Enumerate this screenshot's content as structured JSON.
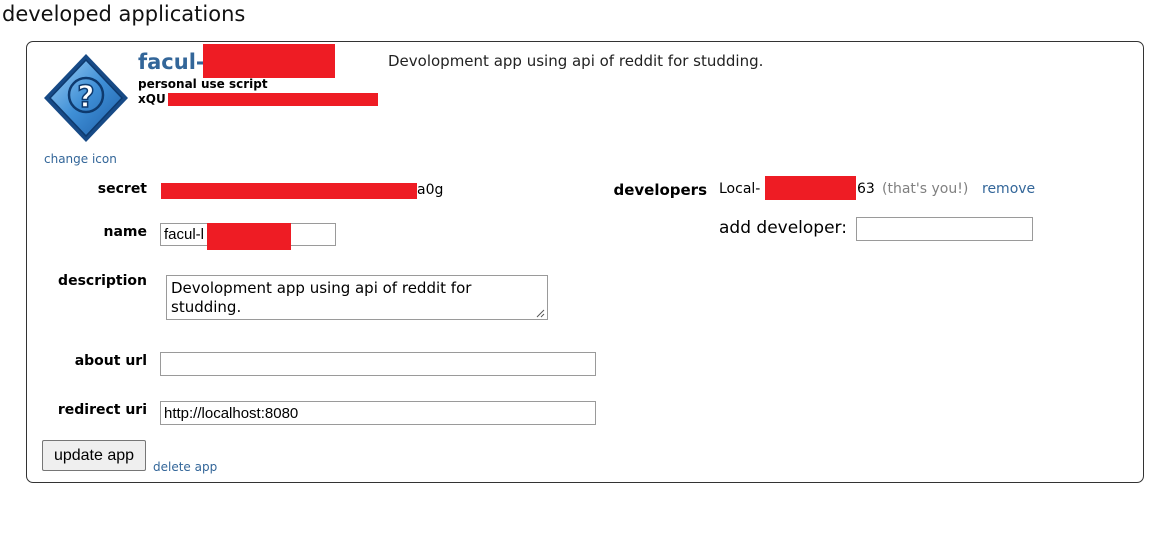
{
  "section_title": "developed applications",
  "app": {
    "name_prefix": "facul-",
    "type": "personal use script",
    "id_prefix": "xQU",
    "description_display": "Devolopment app using api of reddit for studding.",
    "change_icon_label": "change icon",
    "icon": "question-mark-diamond-icon"
  },
  "form": {
    "secret_label": "secret",
    "secret_suffix": "a0g",
    "name_label": "name",
    "name_value": "facul-l",
    "description_label": "description",
    "description_value": "Devolopment app using api of reddit for studding.",
    "about_url_label": "about url",
    "about_url_value": "",
    "redirect_uri_label": "redirect uri",
    "redirect_uri_value": "http://localhost:8080",
    "update_button": "update app",
    "delete_link": "delete app"
  },
  "developers": {
    "label": "developers",
    "name_prefix": "Local-",
    "name_suffix": "63",
    "you_note": "(that's you!)",
    "remove_label": "remove",
    "add_label": "add developer:",
    "add_value": ""
  },
  "colors": {
    "link": "#336699",
    "redaction": "#ee1c24"
  }
}
